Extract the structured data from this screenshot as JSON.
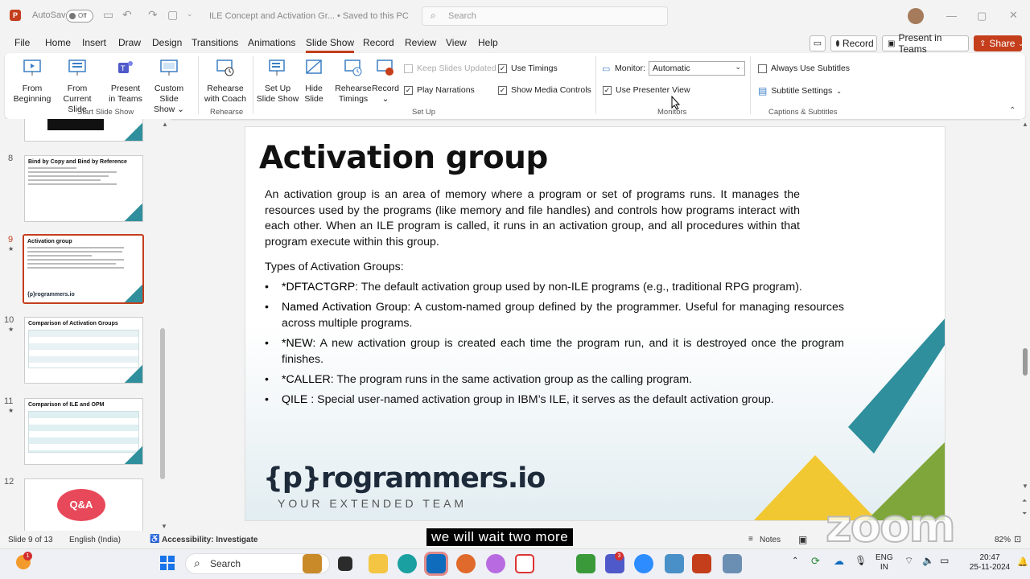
{
  "window": {
    "autosave_label": "AutoSave",
    "autosave_state": "Off",
    "doc_title": "ILE Concept and Activation Gr... • Saved to this PC",
    "search_placeholder": "Search"
  },
  "menu": {
    "tabs": [
      "File",
      "Home",
      "Insert",
      "Draw",
      "Design",
      "Transitions",
      "Animations",
      "Slide Show",
      "Record",
      "Review",
      "View",
      "Help"
    ],
    "active": "Slide Show"
  },
  "top_buttons": {
    "record": "Record",
    "present_in_teams": "Present in Teams",
    "share": "Share"
  },
  "ribbon": {
    "start": {
      "from_beginning": [
        "From",
        "Beginning"
      ],
      "from_current": [
        "From",
        "Current Slide"
      ],
      "present_teams": [
        "Present",
        "in Teams"
      ],
      "custom_show": [
        "Custom Slide",
        "Show"
      ],
      "group": "Start Slide Show"
    },
    "rehearse": {
      "btn": [
        "Rehearse",
        "with Coach"
      ],
      "group": "Rehearse"
    },
    "setup": {
      "setup_show": [
        "Set Up",
        "Slide Show"
      ],
      "hide_slide": [
        "Hide",
        "Slide"
      ],
      "rehearse_timings": [
        "Rehearse",
        "Timings"
      ],
      "record": [
        "Record",
        ""
      ],
      "keep_updated": "Keep Slides Updated",
      "use_timings": "Use Timings",
      "play_narrations": "Play Narrations",
      "show_media": "Show Media Controls",
      "group": "Set Up"
    },
    "monitors": {
      "monitor_label": "Monitor:",
      "monitor_value": "Automatic",
      "presenter_view": "Use Presenter View",
      "group": "Monitors"
    },
    "captions": {
      "always_subtitles": "Always Use Subtitles",
      "subtitle_settings": "Subtitle Settings",
      "group": "Captions & Subtitles"
    }
  },
  "thumbnails": [
    {
      "num": "8",
      "title": "Bind by Copy and Bind by Reference"
    },
    {
      "num": "9",
      "title": "Activation group",
      "logo": "{p}rogrammers.io"
    },
    {
      "num": "10",
      "title": "Comparison of Activation Groups"
    },
    {
      "num": "11",
      "title": "Comparison of ILE and OPM"
    },
    {
      "num": "12",
      "title": "Q&A"
    }
  ],
  "slide": {
    "title": "Activation group",
    "intro": "An activation group is an area of memory where a program or set of programs runs. It manages the resources used by the programs (like memory and file handles) and controls how programs interact with each other. When an ILE program is called, it runs in an activation group, and all procedures within that program execute within this group.",
    "types_heading": "Types of Activation Groups:",
    "bullets": [
      {
        "term": "*DFTACTGRP",
        "text": ": The default activation group used by non-ILE programs (e.g., traditional RPG program)."
      },
      {
        "term": "Named Activation Group",
        "text": ": A custom-named group defined by the programmer. Useful for managing resources across multiple programs."
      },
      {
        "term": "*NEW",
        "text": ": A new activation group is created each time the program run, and it is destroyed once the program finishes."
      },
      {
        "term": "*CALLER",
        "text": ": The program runs in the same activation group as the calling program."
      },
      {
        "term": "QILE :",
        "text": " Special user-named activation group in IBM’s ILE, it serves as the default activation group."
      }
    ],
    "logo": "{p}rogrammers.io",
    "tagline": "YOUR EXTENDED TEAM"
  },
  "status": {
    "slide_counter": "Slide 9 of 13",
    "language": "English (India)",
    "accessibility": "Accessibility: Investigate",
    "notes": "Notes",
    "zoom": "82%"
  },
  "caption_overlay": "we will wait two more",
  "watermark": "zoom",
  "taskbar": {
    "search": "Search",
    "lang": [
      "ENG",
      "IN"
    ],
    "time": "20:47",
    "date": "25-11-2024"
  },
  "colors": {
    "accent": "#c43e1c",
    "teal": "#2f8f9c",
    "yellow": "#f2c832",
    "green": "#7fa63a"
  }
}
